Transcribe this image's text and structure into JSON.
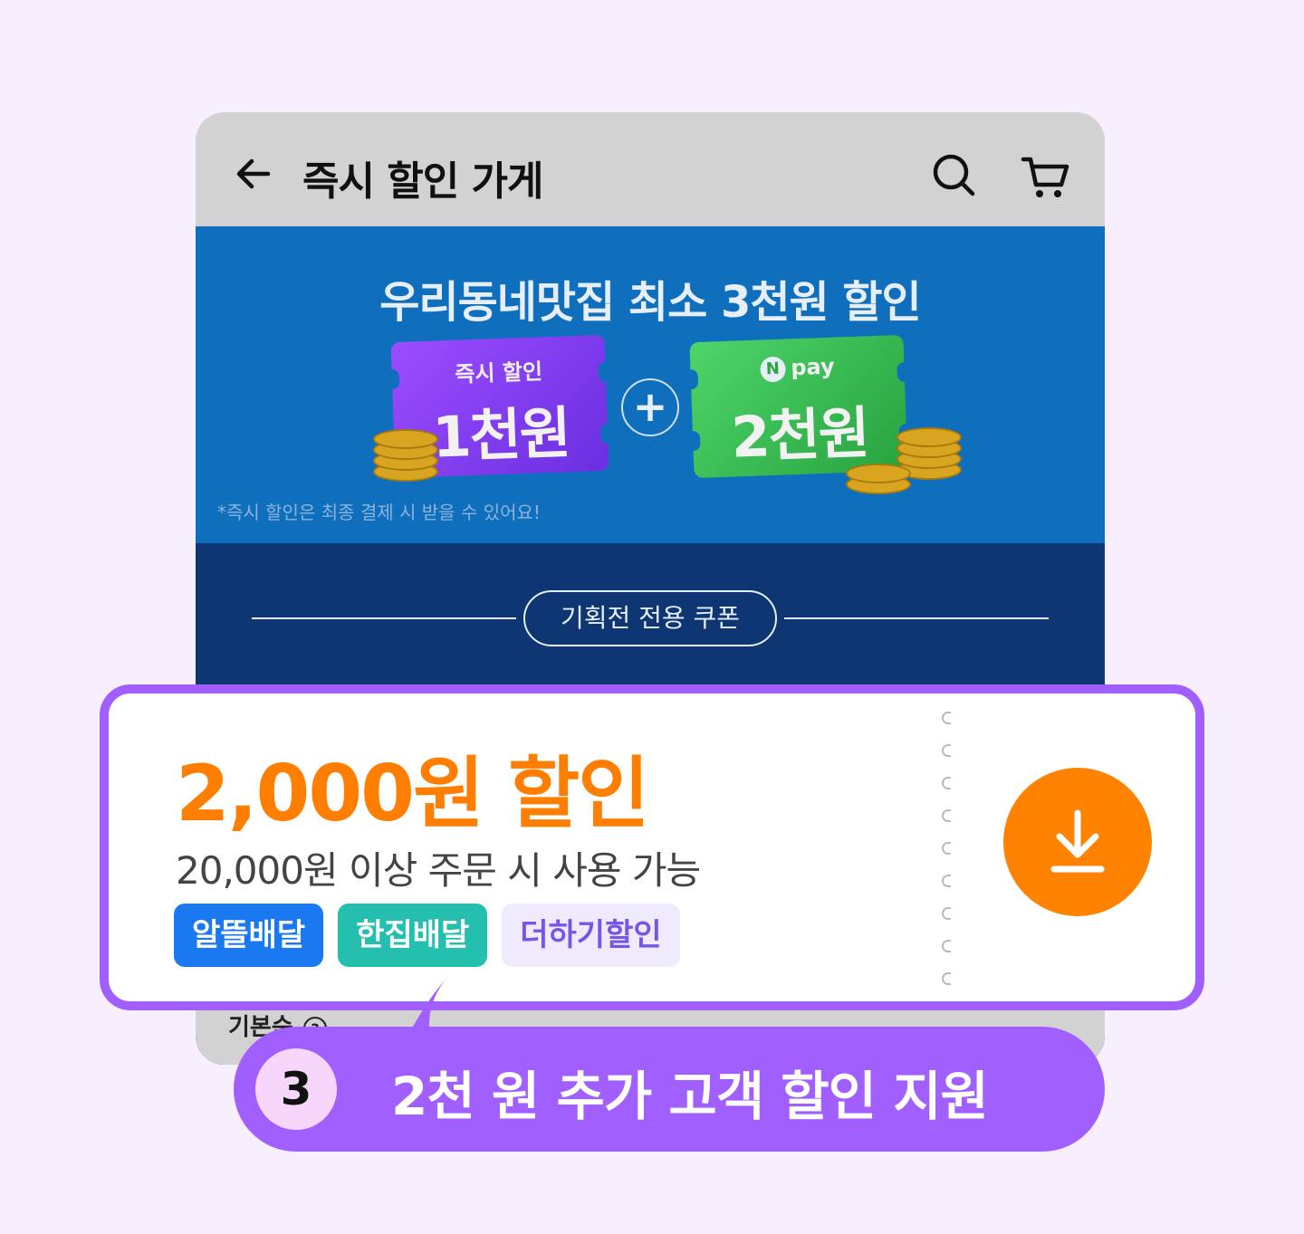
{
  "header": {
    "title": "즉시 할인 가게"
  },
  "banner": {
    "title": "우리동네맛집 최소 3천원 할인",
    "ticket_instant_sub": "즉시 할인",
    "ticket_instant_amount": "1천원",
    "plus": "+",
    "ticket_npay_logo": "N",
    "ticket_npay_sub": "pay",
    "ticket_npay_amount": "2천원",
    "note": "*즉시 할인은 최종 결제 시 받을 수 있어요!"
  },
  "coupon_section": {
    "pill_label": "기획전 전용 쿠폰",
    "basic_label": "기본순"
  },
  "coupon": {
    "amount": "2,000원 할인",
    "condition": "20,000원 이상 주문 시 사용 가능",
    "tags": [
      "알뜰배달",
      "한집배달",
      "더하기할인"
    ]
  },
  "callout": {
    "step": "3",
    "text": "2천 원 추가 고객 할인 지원"
  },
  "colors": {
    "accent_purple": "#a25fff",
    "coupon_orange": "#ff7e00",
    "banner_blue": "#0f6fbd",
    "section_navy": "#0e3672"
  },
  "icons": [
    "back-arrow-icon",
    "search-icon",
    "cart-icon",
    "download-icon",
    "help-icon"
  ]
}
